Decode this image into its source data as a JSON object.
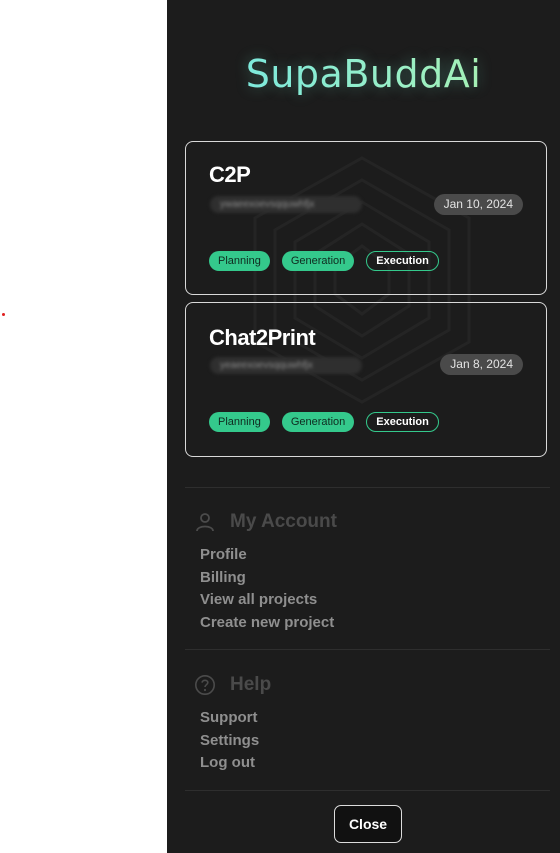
{
  "app": {
    "brand": "SupaBuddAi"
  },
  "projects": [
    {
      "title": "C2P",
      "subtitle": "ywaeexoevsqquwhfjx",
      "date": "Jan 10, 2024",
      "tags": [
        "Planning",
        "Generation",
        "Execution"
      ]
    },
    {
      "title": "Chat2Print",
      "subtitle": "yeaeexoevsqquwhfjx",
      "date": "Jan 8, 2024",
      "tags": [
        "Planning",
        "Generation",
        "Execution"
      ]
    }
  ],
  "account": {
    "heading": "My Account",
    "icon": "user-icon",
    "items": [
      "Profile",
      "Billing",
      "View all projects",
      "Create new project"
    ]
  },
  "help": {
    "heading": "Help",
    "icon": "question-circle-icon",
    "items": [
      "Support",
      "Settings",
      "Log out"
    ]
  },
  "footer": {
    "close_label": "Close"
  },
  "colors": {
    "drawer_bg": "#1c1c1c",
    "accent_green": "#34c98c",
    "brand_gradient_start": "#6fe6ea",
    "brand_gradient_end": "#b5f3a0"
  }
}
